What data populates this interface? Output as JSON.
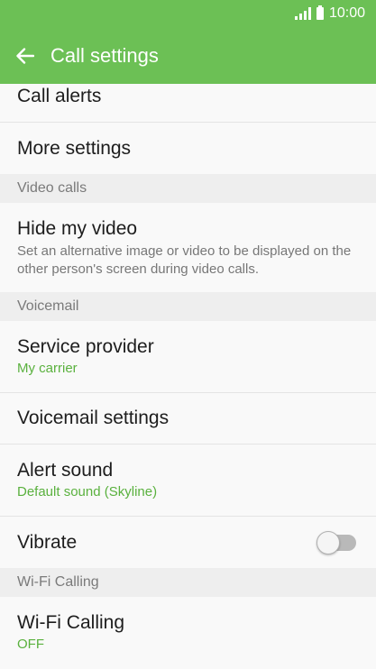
{
  "status_bar": {
    "time": "10:00"
  },
  "app_bar": {
    "title": "Call settings",
    "back_icon": "arrow-left-icon"
  },
  "items": {
    "call_alerts": {
      "title": "Call alerts"
    },
    "more_settings": {
      "title": "More settings"
    },
    "hide_my_video": {
      "title": "Hide my video",
      "description": "Set an alternative image or video to be displayed on the other person's screen during video calls."
    },
    "service_provider": {
      "title": "Service provider",
      "value": "My carrier"
    },
    "voicemail_settings": {
      "title": "Voicemail settings"
    },
    "alert_sound": {
      "title": "Alert sound",
      "value": "Default sound (Skyline)"
    },
    "vibrate": {
      "title": "Vibrate",
      "enabled": false
    },
    "wifi_calling": {
      "title": "Wi-Fi Calling",
      "value": "OFF"
    }
  },
  "sections": {
    "video_calls": "Video calls",
    "voicemail": "Voicemail",
    "wifi_calling": "Wi-Fi Calling"
  },
  "colors": {
    "accent": "#6cc055",
    "value_text": "#5ab13e",
    "section_bg": "#eeeeee"
  }
}
